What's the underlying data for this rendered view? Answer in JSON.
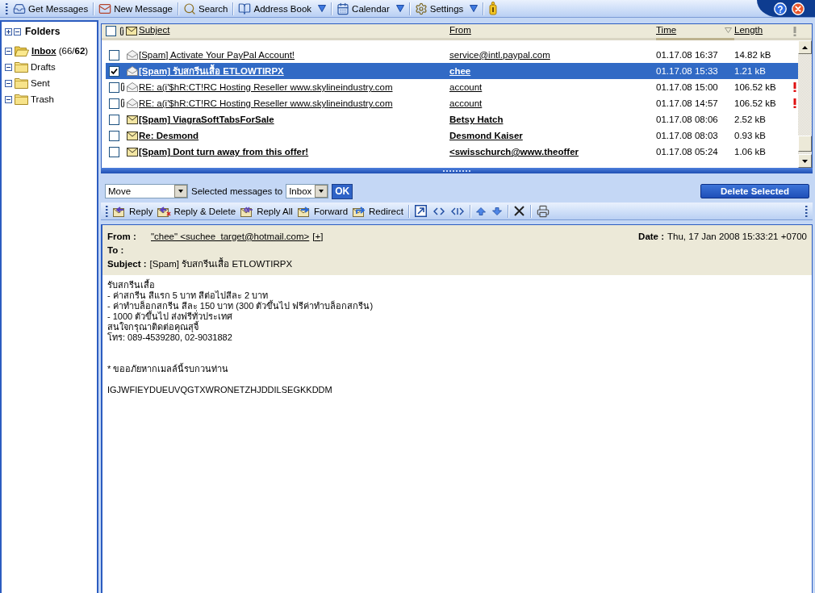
{
  "toolbar": {
    "items": [
      {
        "label": "Get Messages",
        "kind": "button"
      },
      {
        "label": "New Message",
        "kind": "button"
      },
      {
        "label": "Search",
        "kind": "button"
      },
      {
        "label": "Address Book",
        "kind": "menu"
      },
      {
        "label": "Calendar",
        "kind": "menu"
      },
      {
        "label": "Settings",
        "kind": "menu"
      }
    ]
  },
  "folders": {
    "title": "Folders",
    "items": [
      {
        "name": "Inbox",
        "count": "(66/**62**)",
        "selected": true
      },
      {
        "name": "Drafts",
        "selected": false
      },
      {
        "name": "Sent",
        "selected": false
      },
      {
        "name": "Trash",
        "selected": false
      }
    ]
  },
  "message_list": {
    "select_all": {
      "checked": false
    },
    "columns": [
      {
        "label": "Subject",
        "sorted": false
      },
      {
        "label": "From",
        "sorted": false
      },
      {
        "label": "Time",
        "sorted": true
      },
      {
        "label": "Length",
        "sorted": false
      }
    ],
    "rows": [
      {
        "selected": false,
        "checked": false,
        "unread": false,
        "attachment": false,
        "important": false,
        "subject": "[Spam] Activate Your PayPal Account!",
        "from": "service@intl.paypal.com",
        "time": "01.17.08 16:37",
        "length": "14.82 kB"
      },
      {
        "selected": true,
        "checked": true,
        "unread": false,
        "attachment": false,
        "important": false,
        "subject": "[Spam] รับสกรีนเสื้อ ETLOWTIRPX",
        "from": "chee",
        "time": "01.17.08 15:33",
        "length": "1.21 kB"
      },
      {
        "selected": false,
        "checked": false,
        "unread": false,
        "attachment": true,
        "important": true,
        "subject": "RE: a(i'$hR:CT!RC Hosting Reseller www.skylineindustry.com",
        "from": "account",
        "time": "01.17.08 15:00",
        "length": "106.52 kB"
      },
      {
        "selected": false,
        "checked": false,
        "unread": false,
        "attachment": true,
        "important": true,
        "subject": "RE: a(i'$hR:CT!RC Hosting Reseller www.skylineindustry.com",
        "from": "account",
        "time": "01.17.08 14:57",
        "length": "106.52 kB"
      },
      {
        "selected": false,
        "checked": false,
        "unread": true,
        "attachment": false,
        "important": false,
        "subject": "[Spam] ViagraSoftTabsForSale",
        "from": "Betsy Hatch",
        "time": "01.17.08 08:06",
        "length": "2.52 kB"
      },
      {
        "selected": false,
        "checked": false,
        "unread": true,
        "attachment": false,
        "important": false,
        "subject": "Re: Desmond",
        "from": "Desmond Kaiser",
        "time": "01.17.08 08:03",
        "length": "0.93 kB"
      },
      {
        "selected": false,
        "checked": false,
        "unread": true,
        "attachment": false,
        "important": false,
        "subject": "[Spam] Dont turn away from this offer!",
        "from": "<swisschurch@www.theoffer",
        "time": "01.17.08 05:24",
        "length": "1.06 kB"
      }
    ]
  },
  "move_bar": {
    "action": "Move",
    "label": "Selected messages to",
    "target": "Inbox",
    "ok": "OK",
    "delete": "Delete Selected"
  },
  "message_toolbar": {
    "items": [
      {
        "label": "Reply"
      },
      {
        "label": "Reply & Delete"
      },
      {
        "label": "Reply All"
      },
      {
        "label": "Forward"
      },
      {
        "label": "Redirect"
      }
    ]
  },
  "message": {
    "from_label": "From :",
    "from": "\"chee\" <suchee_target@hotmail.com>",
    "from_expand": "[+]",
    "date_label": "Date :",
    "date": "Thu, 17 Jan 2008 15:33:21 +0700",
    "to_label": "To :",
    "subject_label": "Subject :",
    "subject": "[Spam] รับสกรีนเสื้อ ETLOWTIRPX",
    "body": "รับสกรีนเสื้อ\n- ค่าสกรีน สีแรก 5 บาท สีต่อไปสีละ 2 บาท\n- ค่าทำบล็อกสกรีน สีละ 150 บาท (300 ตัวขึ้นไป ฟรีค่าทำบล็อกสกรีน)\n- 1000 ตัวขึ้นไป ส่งฟรีทั่วประเทศ\nสนใจกรุณาติดต่อคุณสุจี้\nโทร: 089-4539280, 02-9031882\n\n\n* ขออภัยหากเมลล์นี้รบกวนท่าน\n\nIGJWFIEYDUEUVQGTXWRONETZHJDDILSEGKKDDM"
  }
}
